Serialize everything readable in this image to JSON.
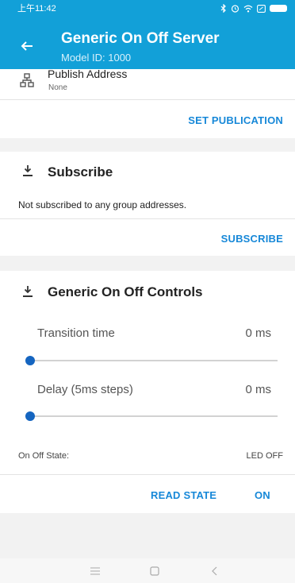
{
  "status_bar": {
    "time": "上午11:42"
  },
  "app_bar": {
    "title": "Generic On Off Server",
    "subtitle": "Model ID: 1000"
  },
  "publication": {
    "label": "Publish Address",
    "value": "None",
    "action_label": "SET PUBLICATION"
  },
  "subscribe": {
    "title": "Subscribe",
    "message": "Not subscribed to any group addresses.",
    "action_label": "SUBSCRIBE"
  },
  "controls": {
    "title": "Generic On Off Controls",
    "transition": {
      "label": "Transition time",
      "value": "0 ms",
      "slider_fraction": 0
    },
    "delay": {
      "label": "Delay (5ms steps)",
      "value": "0 ms",
      "slider_fraction": 0
    },
    "state_label": "On Off State:",
    "state_value": "LED OFF",
    "read_state_label": "READ STATE",
    "on_label": "ON"
  },
  "colors": {
    "app_bar": "#12a0d8",
    "accent": "#1788d8",
    "slider": "#1565c0"
  },
  "icons": {
    "back": "arrow-left",
    "publish": "network",
    "section": "download"
  }
}
